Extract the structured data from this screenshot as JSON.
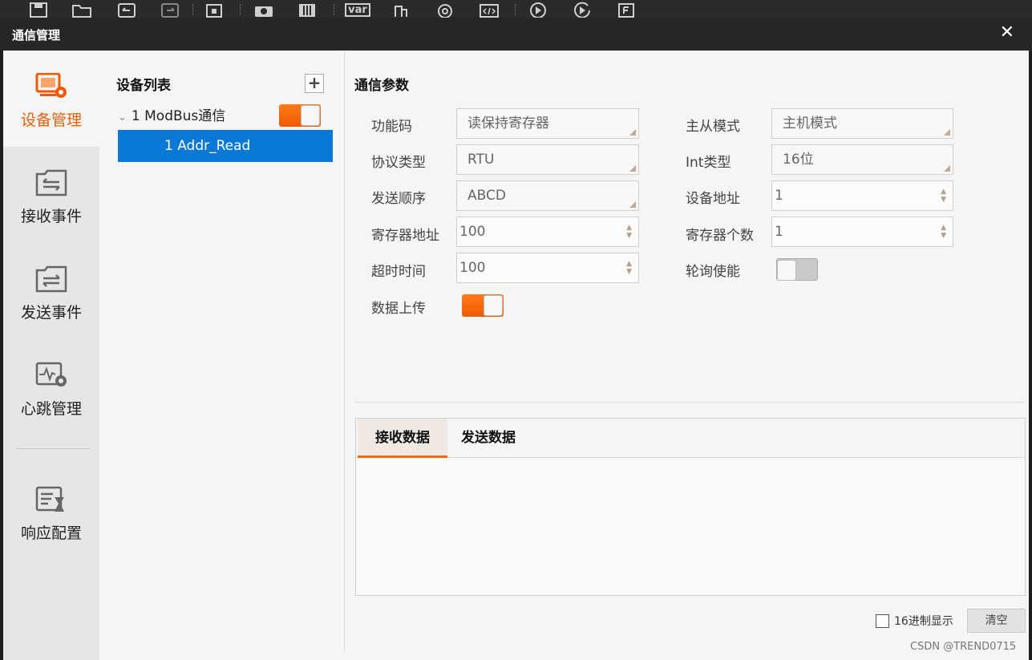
{
  "toolbar": {
    "icons": [
      "save-icon",
      "open-folder-icon",
      "undo-icon",
      "redo-icon",
      "lock-icon",
      "camera-icon",
      "sliders-icon",
      "variable-icon",
      "tool-icon",
      "at-icon",
      "code-icon",
      "play-icon",
      "play-once-icon",
      "file-icon"
    ],
    "var_label": "var"
  },
  "window": {
    "title": "通信管理",
    "close_symbol": "✕"
  },
  "sidebar": {
    "items": [
      {
        "label": "设备管理",
        "icon": "device-gear-icon",
        "active": true
      },
      {
        "label": "接收事件",
        "icon": "receive-folder-icon",
        "active": false
      },
      {
        "label": "发送事件",
        "icon": "send-folder-icon",
        "active": false
      },
      {
        "label": "心跳管理",
        "icon": "heartbeat-gear-icon",
        "active": false
      },
      {
        "label": "响应配置",
        "icon": "response-config-icon",
        "active": false
      }
    ]
  },
  "device_list": {
    "title": "设备列表",
    "add_symbol": "+",
    "parent": {
      "label": "1 ModBus通信",
      "enabled": true
    },
    "child": {
      "label": "1 Addr_Read",
      "selected": true
    }
  },
  "params": {
    "title": "通信参数",
    "function_code": {
      "label": "功能码",
      "value": "读保持寄存器"
    },
    "master_slave": {
      "label": "主从模式",
      "value": "主机模式"
    },
    "protocol_type": {
      "label": "协议类型",
      "value": "RTU"
    },
    "int_type": {
      "label": "Int类型",
      "value": "16位"
    },
    "send_order": {
      "label": "发送顺序",
      "value": "ABCD"
    },
    "device_address": {
      "label": "设备地址",
      "value": "1"
    },
    "register_address": {
      "label": "寄存器地址",
      "value": "100"
    },
    "register_count": {
      "label": "寄存器个数",
      "value": "1"
    },
    "timeout": {
      "label": "超时时间",
      "value": "100"
    },
    "polling_enable": {
      "label": "轮询使能",
      "enabled": false
    },
    "data_upload": {
      "label": "数据上传",
      "enabled": true
    }
  },
  "data_tabs": {
    "tabs": [
      {
        "label": "接收数据",
        "active": true
      },
      {
        "label": "发送数据",
        "active": false
      }
    ],
    "content": ""
  },
  "footer": {
    "hex_display_label": "16进制显示",
    "hex_display_checked": false,
    "clear_label": "清空",
    "watermark": "CSDN @TREND0715"
  },
  "colors": {
    "accent": "#f05a00",
    "selection": "#0a78d7",
    "titlebar": "#262626"
  }
}
